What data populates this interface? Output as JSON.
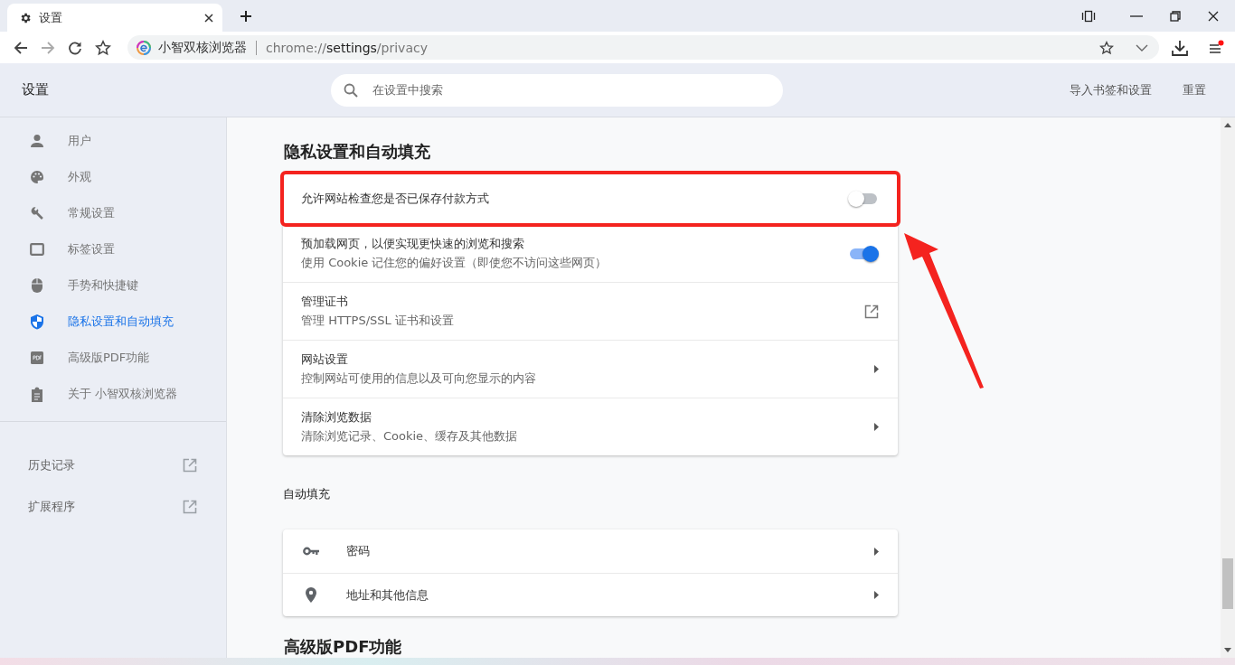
{
  "tab": {
    "title": "设置"
  },
  "address": {
    "site_name": "小智双核浏览器",
    "url_scheme": "chrome://",
    "url_host": "settings",
    "url_path": "/privacy"
  },
  "header": {
    "title": "设置",
    "search_placeholder": "在设置中搜索",
    "actions": [
      "导入书签和设置",
      "重置"
    ]
  },
  "sidebar": {
    "items": [
      {
        "kind": "person",
        "label": "用户",
        "selected": false
      },
      {
        "kind": "palette",
        "label": "外观",
        "selected": false
      },
      {
        "kind": "wrench",
        "label": "常规设置",
        "selected": false
      },
      {
        "kind": "tab",
        "label": "标签设置",
        "selected": false
      },
      {
        "kind": "mouse",
        "label": "手势和快捷键",
        "selected": false
      },
      {
        "kind": "shield",
        "label": "隐私设置和自动填充",
        "selected": true
      },
      {
        "kind": "pdf",
        "label": "高级版PDF功能",
        "selected": false
      },
      {
        "kind": "clipboard",
        "label": "关于 小智双核浏览器",
        "selected": false
      }
    ],
    "links": [
      "历史记录",
      "扩展程序"
    ]
  },
  "privacy": {
    "title": "隐私设置和自动填充",
    "rows": [
      {
        "kind": "toggle",
        "title": "允许网站检查您是否已保存付款方式",
        "on": false,
        "highlighted": true
      },
      {
        "kind": "toggle",
        "title": "预加载网页，以便实现更快速的浏览和搜索",
        "subtitle": "使用 Cookie 记住您的偏好设置（即使您不访问这些网页）",
        "on": true,
        "highlighted": false
      },
      {
        "kind": "external",
        "title": "管理证书",
        "subtitle": "管理 HTTPS/SSL 证书和设置",
        "highlighted": false
      },
      {
        "kind": "submenu",
        "title": "网站设置",
        "subtitle": "控制网站可使用的信息以及可向您显示的内容",
        "highlighted": false
      },
      {
        "kind": "submenu",
        "title": "清除浏览数据",
        "subtitle": "清除浏览记录、Cookie、缓存及其他数据",
        "highlighted": false
      }
    ]
  },
  "autofill": {
    "title": "自动填充",
    "rows": [
      {
        "kind": "key",
        "label": "密码"
      },
      {
        "kind": "pin",
        "label": "地址和其他信息"
      }
    ]
  },
  "next_section": {
    "title": "高级版PDF功能"
  }
}
